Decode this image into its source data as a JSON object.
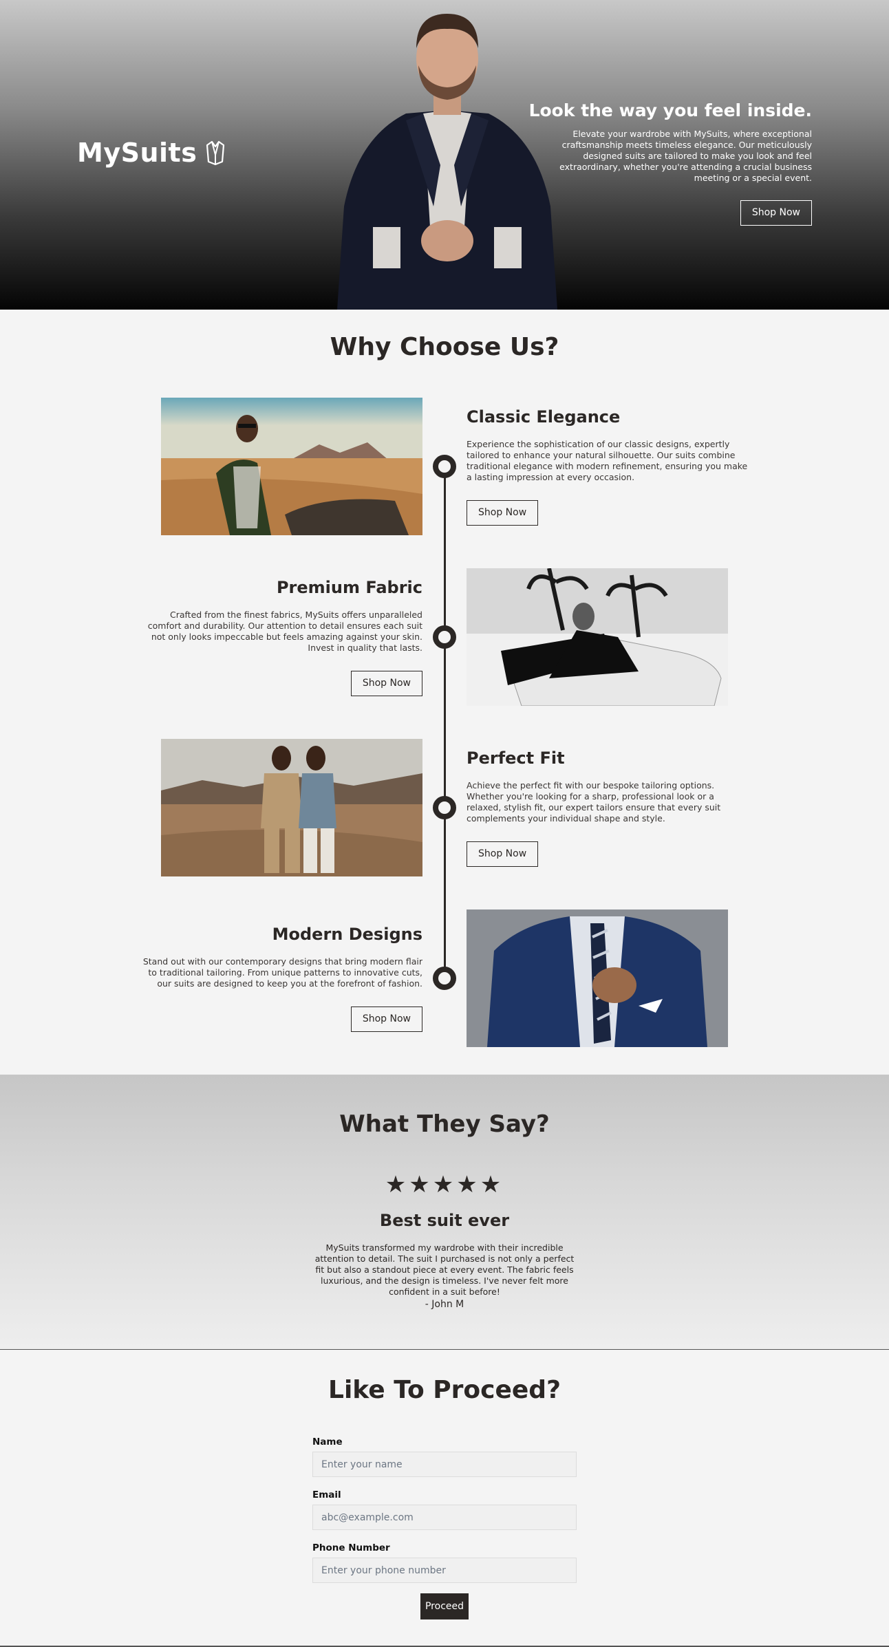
{
  "hero": {
    "brand": "MySuits",
    "title": "Look the way you feel inside.",
    "text": "Elevate your wardrobe with MySuits, where exceptional craftsmanship meets timeless elegance. Our meticulously designed suits are tailored to make you look and feel extraordinary, whether you're attending a crucial business meeting or a special event.",
    "button": "Shop Now"
  },
  "why": {
    "title": "Why Choose Us?",
    "features": [
      {
        "title": "Classic Elegance",
        "text": "Experience the sophistication of our classic designs, expertly tailored to enhance your natural silhouette. Our suits combine traditional elegance with modern refinement, ensuring you make a lasting impression at every occasion.",
        "button": "Shop Now"
      },
      {
        "title": "Premium Fabric",
        "text": "Crafted from the finest fabrics, MySuits offers unparalleled comfort and durability. Our attention to detail ensures each suit not only looks impeccable but feels amazing against your skin. Invest in quality that lasts.",
        "button": "Shop Now"
      },
      {
        "title": "Perfect Fit",
        "text": "Achieve the perfect fit with our bespoke tailoring options. Whether you're looking for a sharp, professional look or a relaxed, stylish fit, our expert tailors ensure that every suit complements your individual shape and style.",
        "button": "Shop Now"
      },
      {
        "title": "Modern Designs",
        "text": "Stand out with our contemporary designs that bring modern flair to traditional tailoring. From unique patterns to innovative cuts, our suits are designed to keep you at the forefront of fashion.",
        "button": "Shop Now"
      }
    ]
  },
  "testimonial": {
    "title": "What They Say?",
    "stars": "★★★★★",
    "rating": 5,
    "heading": "Best suit ever",
    "quote": "MySuits transformed my wardrobe with their incredible attention to detail. The suit I purchased is not only a perfect fit but also a standout piece at every event. The fabric feels luxurious, and the design is timeless. I've never felt more confident in a suit before!",
    "author": "- John M"
  },
  "form": {
    "title": "Like To Proceed?",
    "name_label": "Name",
    "name_placeholder": "Enter your name",
    "email_label": "Email",
    "email_placeholder": "abc@example.com",
    "phone_label": "Phone Number",
    "phone_placeholder": "Enter your phone number",
    "submit": "Proceed"
  }
}
